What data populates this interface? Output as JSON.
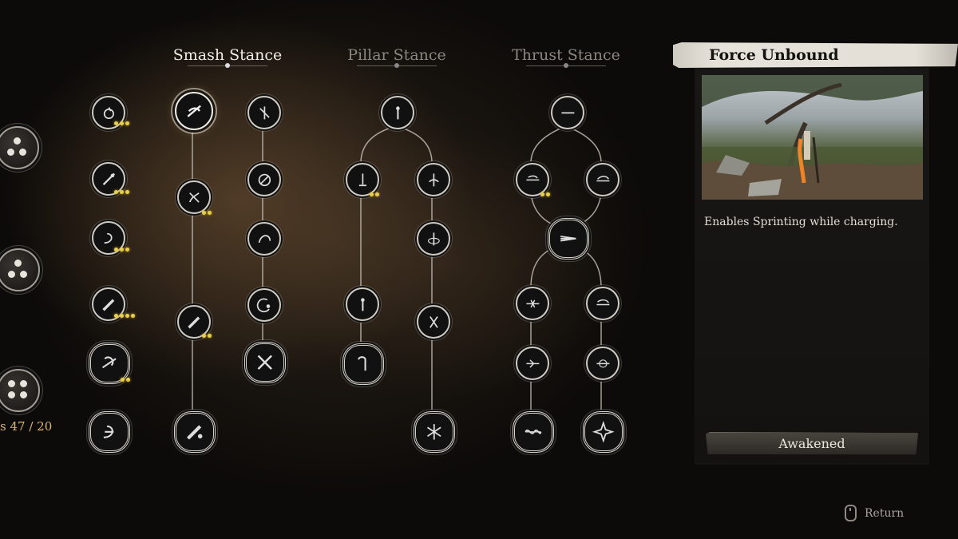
{
  "stance_tabs": [
    {
      "label": "Smash Stance",
      "state": "active"
    },
    {
      "label": "Pillar Stance",
      "state": "inactive"
    },
    {
      "label": "Thrust Stance",
      "state": "inactive"
    }
  ],
  "points": {
    "text": "47 / 20",
    "prefix": "s"
  },
  "selected_skill": {
    "title": "Force Unbound",
    "description": "Enables Sprinting while charging.",
    "status": "Awakened"
  },
  "footer": {
    "return_label": "Return"
  },
  "colors": {
    "accent_gold": "#e9cf48",
    "title_banner": "#e4e0d8",
    "points_text": "#d9b674"
  }
}
